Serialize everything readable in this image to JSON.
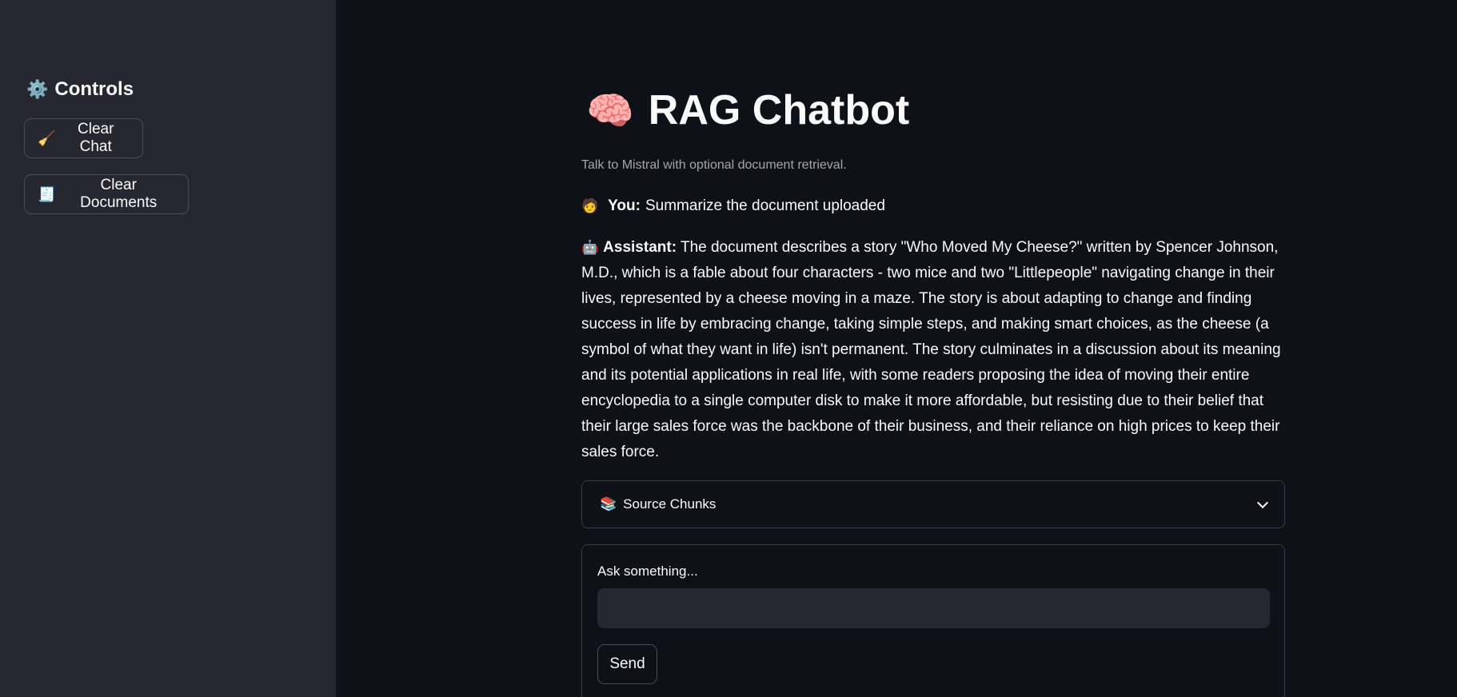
{
  "sidebar": {
    "title_icon": "⚙️",
    "title": "Controls",
    "buttons": [
      {
        "icon": "🧹",
        "icon_name": "broom-icon",
        "label": "Clear Chat"
      },
      {
        "icon": "🧾",
        "icon_name": "receipt-icon",
        "label": "Clear Documents"
      }
    ]
  },
  "main": {
    "title_icon": "🧠",
    "title": "RAG Chatbot",
    "subtitle": "Talk to Mistral with optional document retrieval.",
    "messages": [
      {
        "icon": "🧑",
        "role": "You:",
        "text": "Summarize the document uploaded"
      },
      {
        "icon": "🤖",
        "role": "Assistant:",
        "text": "The document describes a story \"Who Moved My Cheese?\" written by Spencer Johnson, M.D., which is a fable about four characters - two mice and two \"Littlepeople\" navigating change in their lives, represented by a cheese moving in a maze. The story is about adapting to change and finding success in life by embracing change, taking simple steps, and making smart choices, as the cheese (a symbol of what they want in life) isn't permanent. The story culminates in a discussion about its meaning and its potential applications in real life, with some readers proposing the idea of moving their entire encyclopedia to a single computer disk to make it more affordable, but resisting due to their belief that their large sales force was the backbone of their business, and their reliance on high prices to keep their sales force."
      }
    ],
    "expander": {
      "icon": "📚",
      "label": "Source Chunks"
    },
    "form": {
      "input_label": "Ask something...",
      "input_value": "",
      "send_label": "Send"
    }
  },
  "colors": {
    "background": "#0e1117",
    "sidebar": "#262730",
    "input_bg": "#262730",
    "text": "#fafafa",
    "muted_text": "#a3a6ad"
  }
}
